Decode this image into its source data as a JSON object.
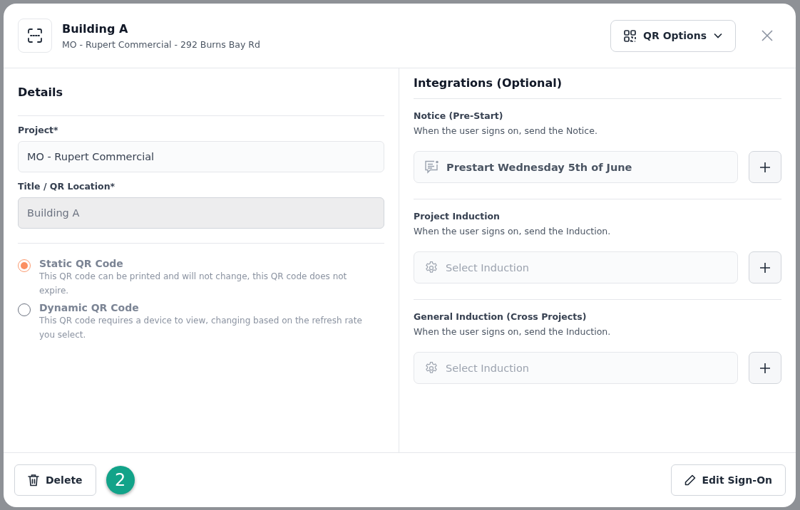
{
  "header": {
    "title": "Building A",
    "subtitle": "MO - Rupert Commercial - 292 Burns Bay Rd",
    "options_button": "QR Options"
  },
  "details": {
    "heading": "Details",
    "fields": [
      {
        "label": "Project*",
        "value": "MO - Rupert Commercial",
        "disabled": false
      },
      {
        "label": "Title / QR Location*",
        "value": "Building A",
        "disabled": true
      }
    ],
    "qr_types": [
      {
        "label": "Static QR Code",
        "description": "This QR code can be printed and will not change, this QR code does not expire.",
        "selected": true
      },
      {
        "label": "Dynamic QR Code",
        "description": "This QR code requires a device to view, changing based on the refresh rate you select.",
        "selected": false
      }
    ]
  },
  "integrations": {
    "heading": "Integrations (Optional)",
    "items": [
      {
        "kind": "notice",
        "title": "Notice (Pre-Start)",
        "description": "When the user signs on, send the Notice.",
        "value": "Prestart Wednesday 5th of June"
      },
      {
        "kind": "induction",
        "title": "Project Induction",
        "description": "When the user signs on, send the Induction.",
        "placeholder": "Select Induction"
      },
      {
        "kind": "induction",
        "title": "General Induction (Cross Projects)",
        "description": "When the user signs on, send the Induction.",
        "placeholder": "Select Induction"
      }
    ]
  },
  "footer": {
    "delete_button": "Delete",
    "step_badge": "2",
    "edit_button": "Edit Sign-On"
  }
}
